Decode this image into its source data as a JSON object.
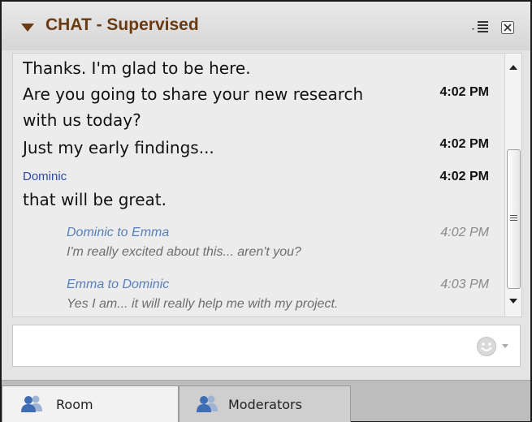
{
  "panel": {
    "title": "CHAT - Supervised",
    "icons": {
      "collapse": "triangle-down-icon",
      "menu": "menu-icon",
      "close": "close-icon"
    }
  },
  "messages": {
    "line1": "Thanks. I'm glad to be here.",
    "line2": "Are you going to share your new research",
    "line2_time": "4:02 PM",
    "line3": "with us today?",
    "line4": "Just my early findings...",
    "line4_time": "4:02 PM",
    "sender": "Dominic",
    "sender_time": "4:02 PM",
    "line5": "that will be great.",
    "whisper1_head": "Dominic to Emma",
    "whisper1_time": "4:02 PM",
    "whisper1_body": "I'm really excited about this... aren't you?",
    "whisper2_head": "Emma to Dominic",
    "whisper2_time": "4:03 PM",
    "whisper2_body": "Yes I am... it will really help me with my project."
  },
  "input": {
    "value": "",
    "placeholder": ""
  },
  "tabs": [
    {
      "label": "Room",
      "icon": "people-icon",
      "active": true
    },
    {
      "label": "Moderators",
      "icon": "people-icon",
      "active": false
    }
  ],
  "colors": {
    "title": "#6a3b12",
    "sender": "#2d4a9c",
    "whisper_head": "#5a7fb8",
    "whisper_body": "#6e6e6e"
  }
}
